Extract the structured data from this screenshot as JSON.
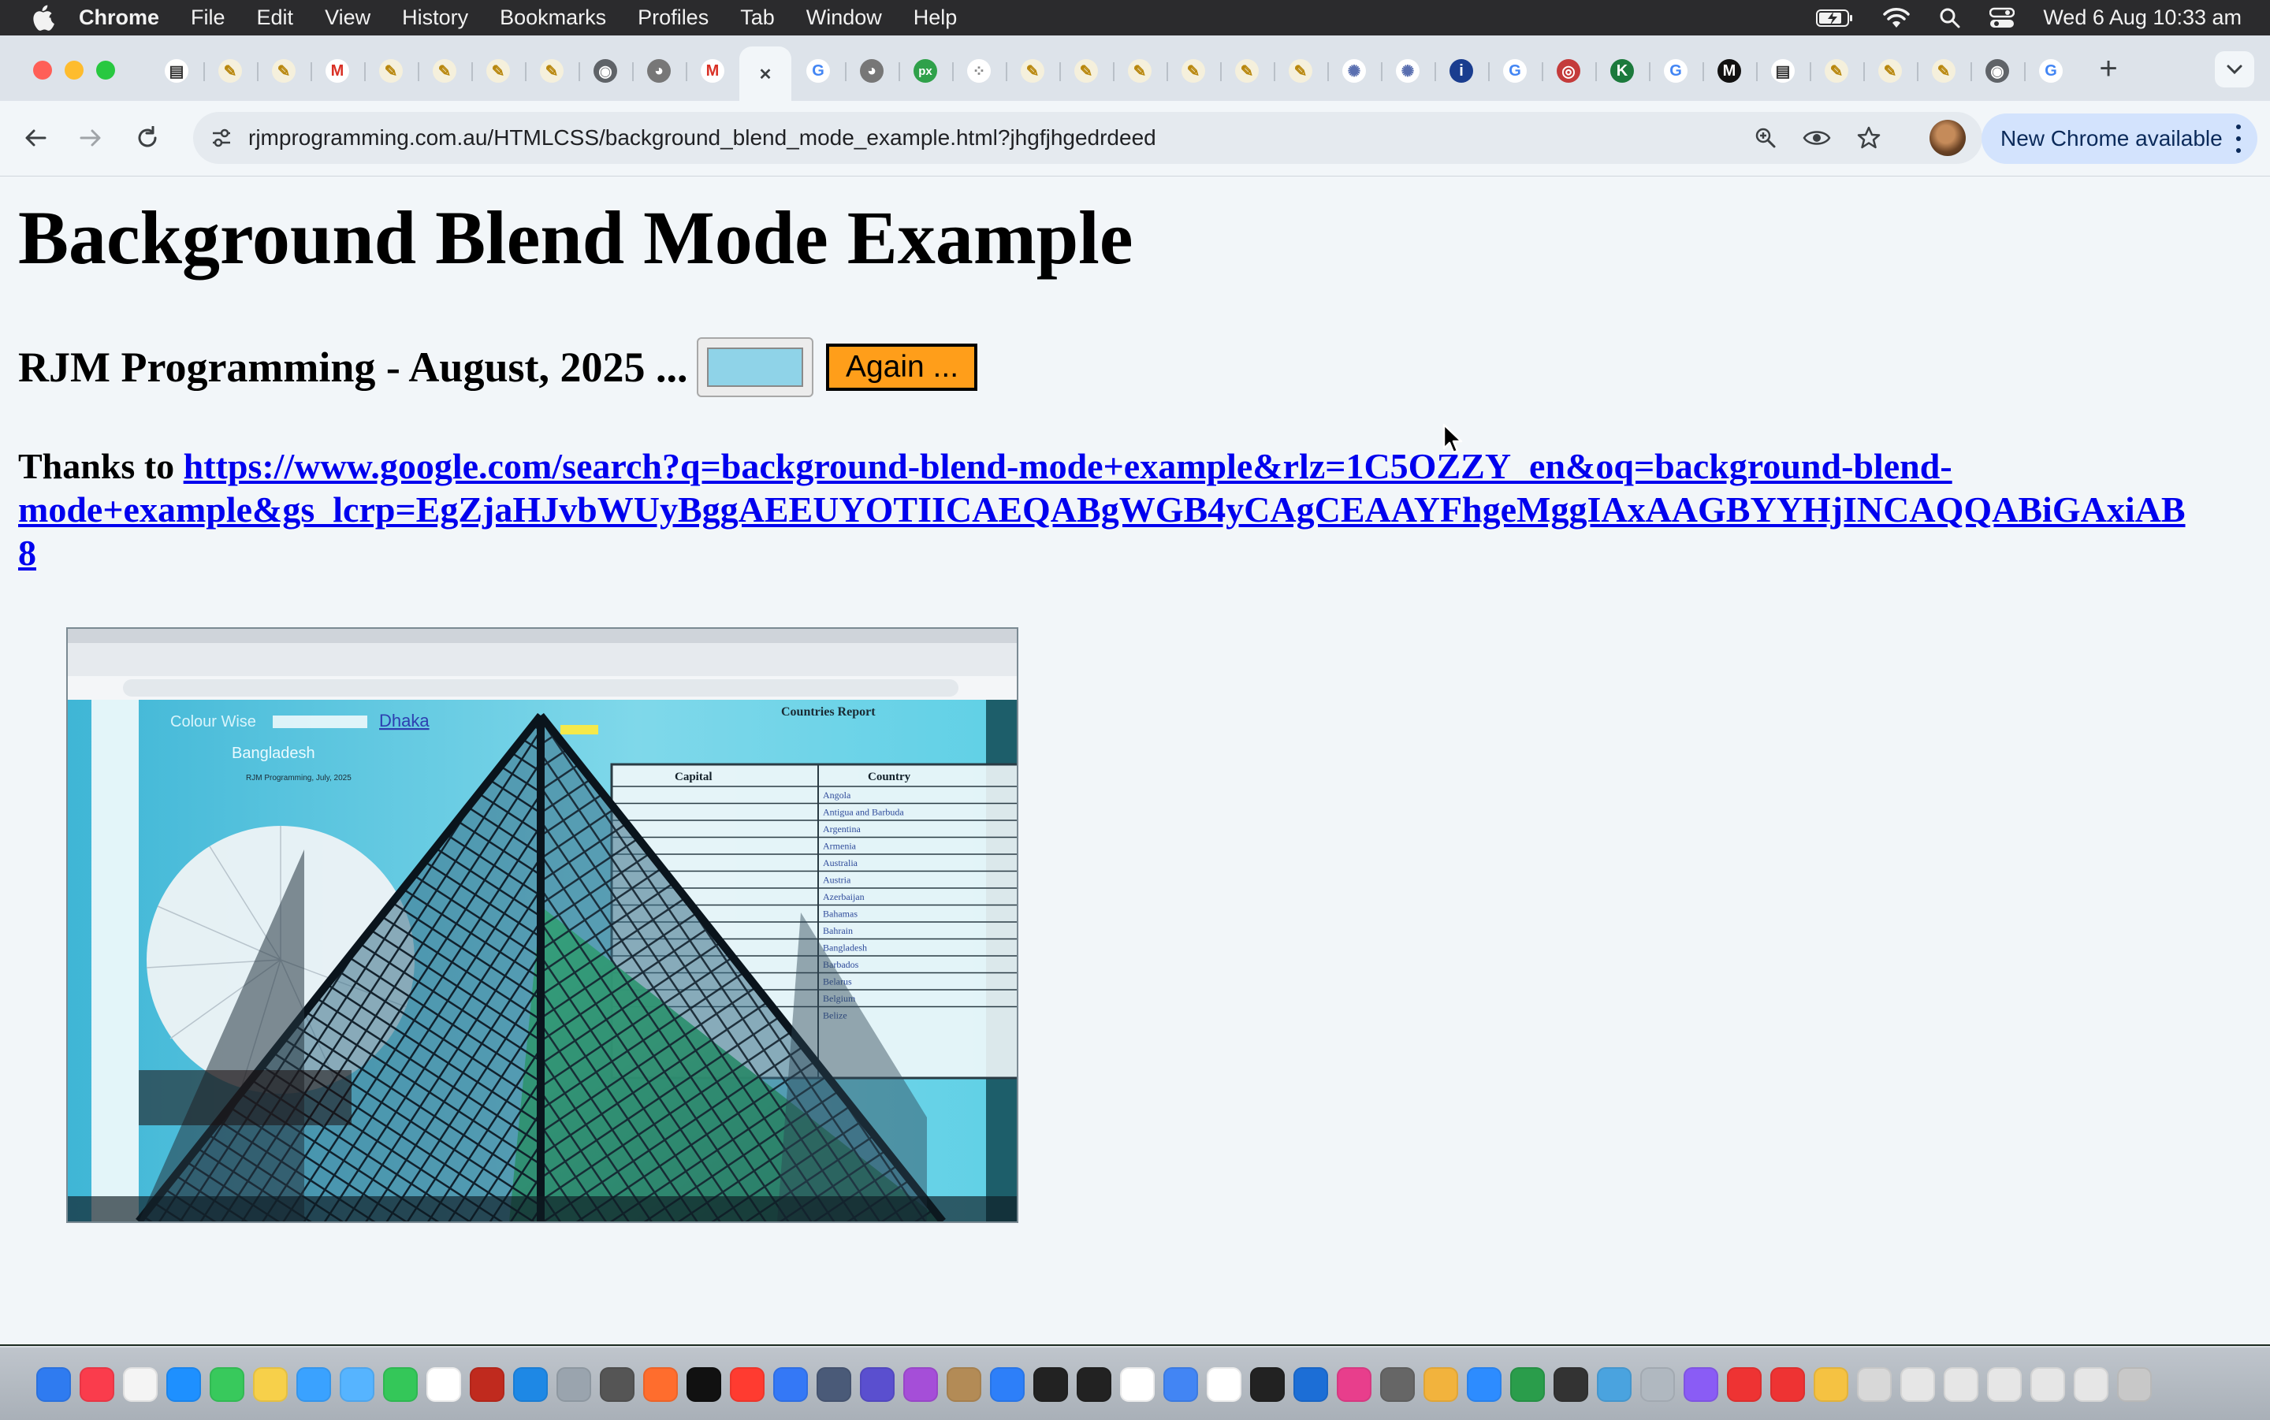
{
  "menubar": {
    "app_name": "Chrome",
    "items": [
      "File",
      "Edit",
      "View",
      "History",
      "Bookmarks",
      "Profiles",
      "Tab",
      "Window",
      "Help"
    ],
    "clock": "Wed 6 Aug  10:33 am"
  },
  "tabs": {
    "active_index": 11,
    "favicons": [
      "doc",
      "pen",
      "pen",
      "gmail",
      "pen",
      "pen",
      "pen",
      "pen",
      "chrome",
      "ghost",
      "gmail",
      "close",
      "google",
      "ghost",
      "px",
      "dots",
      "pen",
      "pen",
      "pen",
      "pen",
      "pen",
      "pen",
      "spin",
      "spin",
      "info",
      "google",
      "globe",
      "k",
      "google",
      "m",
      "doc",
      "pen",
      "pen",
      "pen",
      "chrome",
      "google"
    ]
  },
  "toolbar": {
    "url": "rjmprogramming.com.au/HTMLCSS/background_blend_mode_example.html?jhgfjhgedrdeed",
    "update_label": "New Chrome available"
  },
  "page": {
    "title": "Background Blend Mode Example",
    "subtitle": "RJM Programming - August, 2025 ...",
    "color_value": "#8fd3e8",
    "again_label": "Again ...",
    "thanks_prefix": "Thanks to ",
    "link_line1": "https://www.google.com/search?q=background-blend-mode+example&rlz=1C5OZZY_en&oq=background-blend-",
    "link_line2": "mode+example&gs_lcrp=EgZjaHJvbWUyBggAEEUYOTIICAEQABgWGB4yCAgCEAAYFhgeMggIAxAAGBYYHjINCAQQABiGAxiAB",
    "link_line3": "8",
    "screenshot_text": {
      "report_title": "Countries Report",
      "col_capital": "Capital",
      "col_country": "Country",
      "countries": [
        "Angola",
        "Antigua and Barbuda",
        "Argentina",
        "Armenia",
        "Australia",
        "Austria",
        "Azerbaijan",
        "Bahamas",
        "Bahrain",
        "Bangladesh",
        "Barbados",
        "Belarus",
        "Belgium",
        "Belize"
      ],
      "color_wise": "Colour Wise",
      "city": "Dhaka",
      "country_heading": "Bangladesh",
      "byline": "RJM Programming, July, 2025"
    }
  },
  "colors": {
    "accent_button": "#ff9e1a",
    "link": "#0000ee",
    "chip_bg": "#d3e3fd"
  }
}
